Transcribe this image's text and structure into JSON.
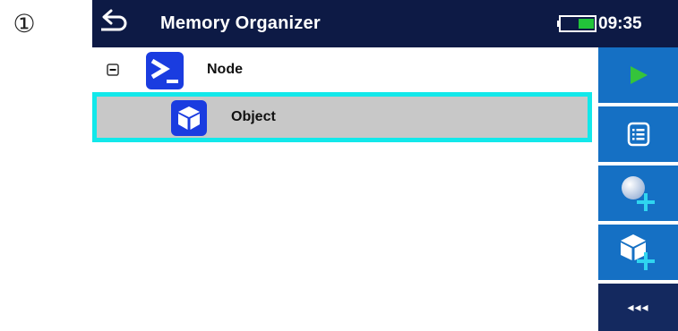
{
  "step_marker": "①",
  "titlebar": {
    "title": "Memory Organizer",
    "time": "09:35"
  },
  "tree": {
    "node": {
      "label": "Node",
      "icon": "terminal-node-icon",
      "expanded": true
    },
    "object": {
      "label": "Object",
      "icon": "object-cube-icon",
      "selected": true
    }
  },
  "sidebar": {
    "more_label": "◂◂◂",
    "buttons": [
      {
        "icon": "play-icon"
      },
      {
        "icon": "list-icon"
      },
      {
        "icon": "add-measurement-icon"
      },
      {
        "icon": "add-object-icon"
      }
    ]
  },
  "colors": {
    "titlebar_bg": "#0d1a45",
    "sidebar_bg": "#1570c4",
    "sidebar_more_bg": "#14295f",
    "selection_border": "#12e8ea",
    "selection_bg": "#c8c8c8",
    "play_green": "#35c43b",
    "plus_cyan": "#2fd5f0",
    "icon_blue": "#1a3ce0"
  }
}
